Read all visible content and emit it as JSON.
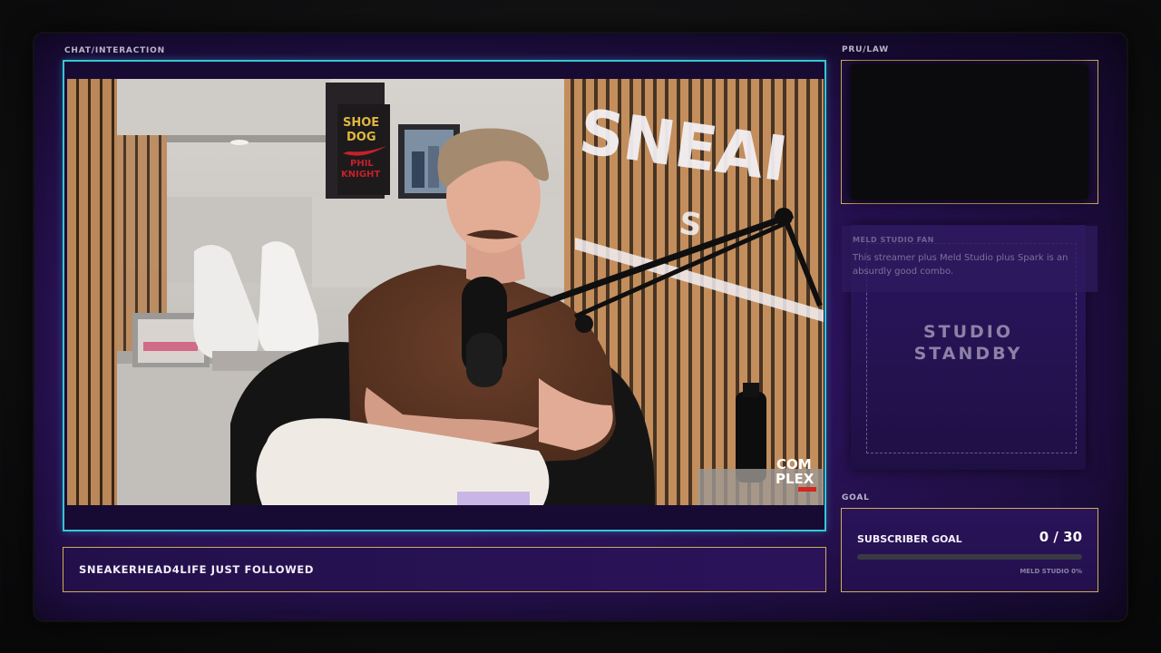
{
  "labels": {
    "chat": "CHAT/INTERACTION",
    "pru": "PRU/LAW",
    "goal": "GOAL"
  },
  "alert": {
    "text": "SNEAKERHEAD4LIFE JUST FOLLOWED"
  },
  "video": {
    "book_title_1": "SHOE",
    "book_title_2": "DOG",
    "book_author_1": "PHIL",
    "book_author_2": "KNIGHT",
    "wall_sign_1": "SNEAI",
    "wall_sign_2": "S",
    "watermark_1": "COM",
    "watermark_2": "PLEX"
  },
  "fan": {
    "title": "MELD STUDIO FAN",
    "message": "This streamer plus Meld Studio plus Spark is an absurdly good combo."
  },
  "standby": {
    "line1": "STUDIO",
    "line2": "STANDBY"
  },
  "goal": {
    "title": "SUBSCRIBER GOAL",
    "count": "0 / 30",
    "progress_fraction": 0,
    "footer": "MELD STUDIO 0%"
  },
  "colors": {
    "cam_border": "#35c6d8",
    "gold_border": "#cfae55",
    "panel_purple": "#2a1257"
  }
}
